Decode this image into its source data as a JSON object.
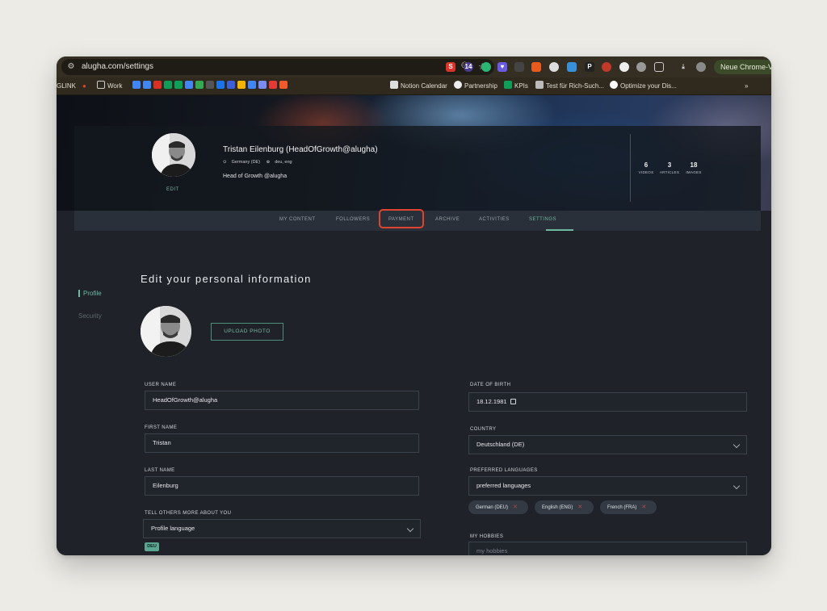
{
  "browser": {
    "url": "alugha.com/settings",
    "extension_badge": "14",
    "update_button": "Neue Chrome-Ve",
    "bookmarks": [
      "GLINK",
      "Work",
      "Notion Calendar",
      "Partnership",
      "KPIs",
      "Test für Rich-Such...",
      "Optimize your Dis..."
    ],
    "more": "»"
  },
  "profile": {
    "name": "Tristan Eilenburg (HeadOfGrowth@alugha)",
    "location": "Germany (DE)",
    "languages": "deu, eng",
    "tagline": "Head of Growth @alugha",
    "edit_label": "EDIT",
    "stats": [
      {
        "value": "6",
        "label": "VIDEOS"
      },
      {
        "value": "3",
        "label": "ARTICLES"
      },
      {
        "value": "18",
        "label": "IMAGES"
      }
    ]
  },
  "tabs": [
    "MY CONTENT",
    "FOLLOWERS",
    "PAYMENT",
    "ARCHIVE",
    "ACTIVITIES",
    "SETTINGS"
  ],
  "sidebar": {
    "profile": "Profile",
    "security": "Security"
  },
  "form": {
    "heading": "Edit your personal information",
    "upload_label": "UPLOAD PHOTO",
    "username_label": "USER NAME",
    "username": "HeadOfGrowth@alugha",
    "firstname_label": "FIRST NAME",
    "firstname": "Tristan",
    "lastname_label": "LAST NAME",
    "lastname": "Eilenburg",
    "about_label": "TELL OTHERS MORE ABOUT YOU",
    "profile_language": "Profile language",
    "about_badge": "DEU",
    "dob_label": "DATE OF BIRTH",
    "dob": "18.12.1981",
    "country_label": "COUNTRY",
    "country": "Deutschland (DE)",
    "languages_label": "PREFERRED LANGUAGES",
    "languages_placeholder": "preferred languages",
    "language_chips": [
      "German (DEU)",
      "English (ENG)",
      "French (FRA)"
    ],
    "hobbies_label": "MY HOBBIES",
    "hobbies_placeholder": "my hobbies"
  },
  "colors": {
    "accent": "#6fb8a1",
    "highlight": "#e0442e",
    "background": "#1f2329"
  }
}
